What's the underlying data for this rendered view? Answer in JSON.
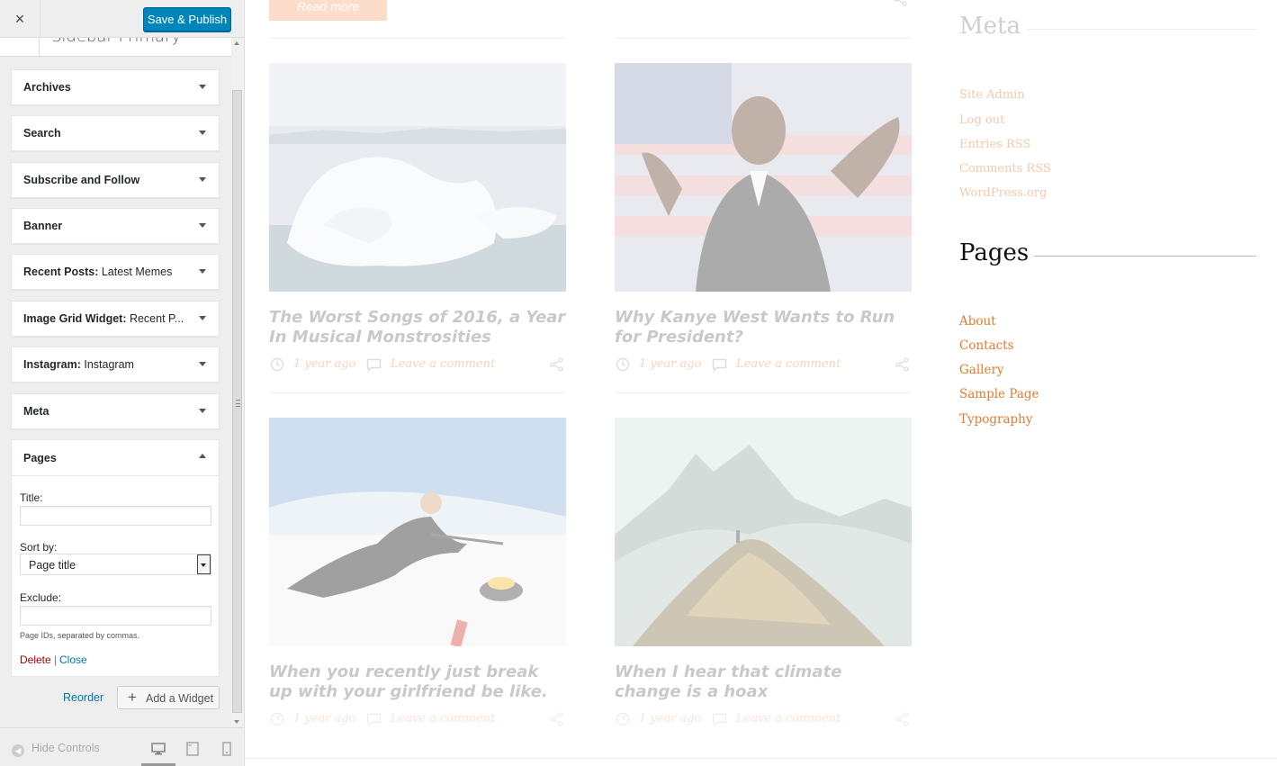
{
  "customizer": {
    "close_label": "×",
    "publish_label": "Save & Publish",
    "section_title": "Sidebar Primary",
    "widgets": [
      {
        "title": "Archives",
        "subtitle": ""
      },
      {
        "title": "Search",
        "subtitle": ""
      },
      {
        "title": "Subscribe and Follow",
        "subtitle": ""
      },
      {
        "title": "Banner",
        "subtitle": ""
      },
      {
        "title": "Recent Posts:",
        "subtitle": " Latest Memes"
      },
      {
        "title": "Image Grid Widget:",
        "subtitle": " Recent P..."
      },
      {
        "title": "Instagram:",
        "subtitle": " Instagram"
      },
      {
        "title": "Meta",
        "subtitle": ""
      }
    ],
    "pages_widget": {
      "title": "Pages",
      "title_label": "Title:",
      "title_value": "",
      "sortby_label": "Sort by:",
      "sortby_value": "Page title",
      "exclude_label": "Exclude:",
      "exclude_value": "",
      "exclude_help": "Page IDs, separated by commas.",
      "delete_label": "Delete",
      "separator": "|",
      "close_label": "Close"
    },
    "reorder_label": "Reorder",
    "add_widget_label": "Add a Widget",
    "hide_controls_label": "Hide Controls"
  },
  "preview": {
    "read_more_label": "Read more",
    "posts": [
      {
        "title": "The Worst Songs of 2016, a Year In Musical Monstrosities",
        "time": "1 year ago",
        "comment": "Leave a comment"
      },
      {
        "title": "Why Kanye West Wants to Run for President?",
        "time": "1 year ago",
        "comment": "Leave a comment"
      },
      {
        "title": "When you recently just break up with your girlfriend be like.",
        "time": "1 year ago",
        "comment": "Leave a comment"
      },
      {
        "title": "When I hear that climate change is a hoax",
        "time": "1 year ago",
        "comment": "Leave a comment"
      }
    ],
    "meta_widget": {
      "heading": "Meta",
      "links": [
        "Site Admin",
        "Log out",
        "Entries RSS",
        "Comments RSS",
        "WordPress.org"
      ]
    },
    "pages_widget": {
      "heading": "Pages",
      "links": [
        "About",
        "Contacts",
        "Gallery",
        "Sample Page",
        "Typography"
      ]
    }
  },
  "colors": {
    "publish_button": "#0085ba",
    "accent_orange": "#e07b2f",
    "delete_red": "#aa0000",
    "link_blue": "#0073aa"
  }
}
